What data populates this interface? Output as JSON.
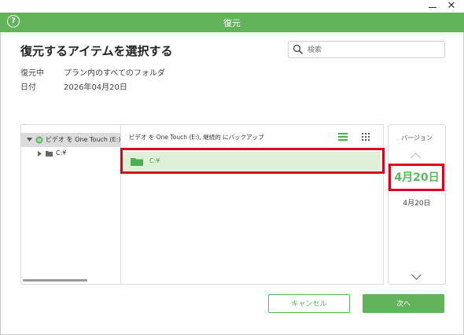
{
  "window": {
    "close_glyph": "✕",
    "title": "復元",
    "help_glyph": "?"
  },
  "page": {
    "heading": "復元するアイテムを選択する"
  },
  "search": {
    "placeholder": "検索"
  },
  "info": {
    "restore_label": "復元中",
    "restore_value": "プラン内のすべてのフォルダ",
    "date_label": "日付",
    "date_value": "2026年04月20日"
  },
  "tree": {
    "root_label": "ビデオ を One Touch (E:), 継",
    "child_label": "C:¥"
  },
  "files": {
    "header": "ビデオ を One Touch (E:), 継続的 にバックアップ",
    "items": [
      {
        "name": "C:¥"
      }
    ]
  },
  "versions": {
    "title": "バージョン",
    "current": "4月20日",
    "items": [
      "4月20日"
    ]
  },
  "buttons": {
    "cancel": "キャンセル",
    "next": "次へ"
  },
  "colors": {
    "accent": "#63b35a",
    "highlight_row": "#dff0d8",
    "annotation_red": "#e0001b"
  }
}
